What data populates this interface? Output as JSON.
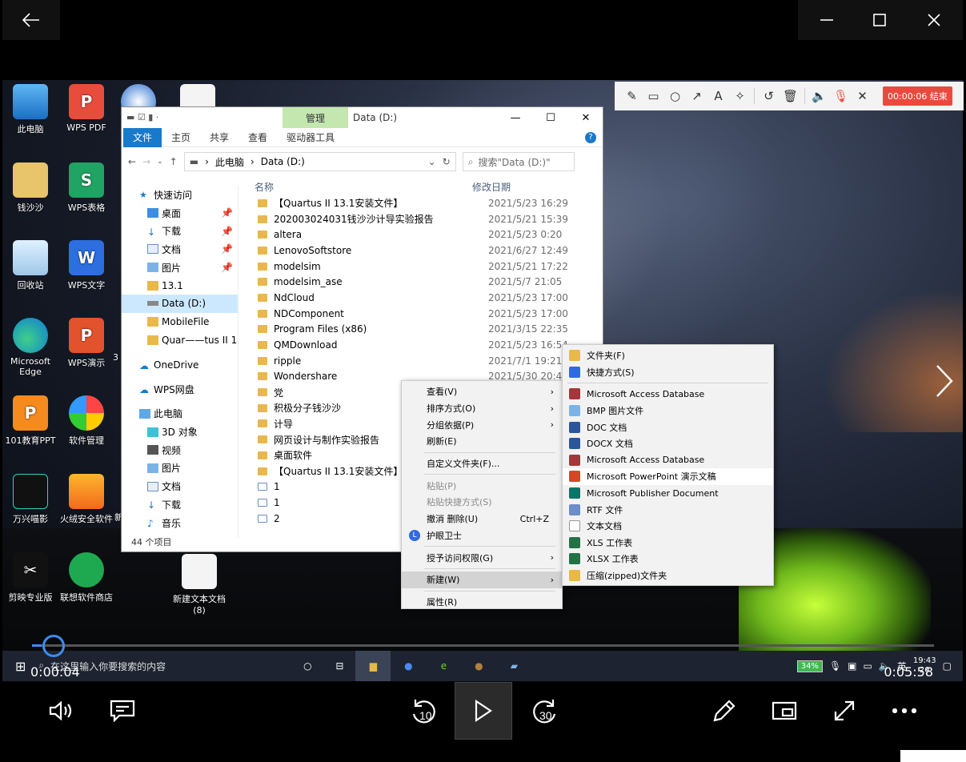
{
  "player": {
    "time_current": "0:00:04",
    "time_total": "0:05:58",
    "progress": 0.011,
    "skip_back": "10",
    "skip_forward": "30"
  },
  "recorder": {
    "end_label": "00:00:06 结束"
  },
  "desktop": {
    "icons": [
      {
        "label": "此电脑"
      },
      {
        "label": "WPS PDF"
      },
      {
        "label": "钱沙沙"
      },
      {
        "label": "WPS表格"
      },
      {
        "label": "回收站"
      },
      {
        "label": "WPS文字"
      },
      {
        "label": "Microsoft Edge"
      },
      {
        "label": "WPS演示"
      },
      {
        "label": "101教育PPT"
      },
      {
        "label": "软件管理"
      },
      {
        "label": "万兴喵影"
      },
      {
        "label": "火绒安全软件"
      },
      {
        "label": "剪映专业版"
      },
      {
        "label": "联想软件商店"
      },
      {
        "label": "新建文本文档 (8)"
      }
    ],
    "partial_labels": [
      "1",
      "3",
      "新"
    ]
  },
  "explorer": {
    "manage_tab": "管理",
    "title": "Data (D:)",
    "ribbon": [
      "文件",
      "主页",
      "共享",
      "查看",
      "驱动器工具"
    ],
    "breadcrumb": [
      "此电脑",
      "Data (D:)"
    ],
    "search_placeholder": "搜索\"Data (D:)\"",
    "col_name": "名称",
    "col_date": "修改日期",
    "nav": [
      {
        "label": "快速访问"
      },
      {
        "label": "桌面"
      },
      {
        "label": "下载"
      },
      {
        "label": "文档"
      },
      {
        "label": "图片"
      },
      {
        "label": "13.1"
      },
      {
        "label": "Data (D:)"
      },
      {
        "label": "MobileFile"
      },
      {
        "label": "Quar——tus II 1"
      },
      {
        "label": "OneDrive"
      },
      {
        "label": "WPS网盘"
      },
      {
        "label": "此电脑"
      },
      {
        "label": "3D 对象"
      },
      {
        "label": "视频"
      },
      {
        "label": "图片"
      },
      {
        "label": "文档"
      },
      {
        "label": "下载"
      },
      {
        "label": "音乐"
      }
    ],
    "files": [
      {
        "name": "【Quartus II 13.1安装文件】",
        "date": "2021/5/23 16:29"
      },
      {
        "name": "202003024031钱沙沙计导实验报告",
        "date": "2021/5/21 15:39"
      },
      {
        "name": "altera",
        "date": "2021/5/23 0:20"
      },
      {
        "name": "LenovoSoftstore",
        "date": "2021/6/27 12:49"
      },
      {
        "name": "modelsim",
        "date": "2021/5/21 17:22"
      },
      {
        "name": "modelsim_ase",
        "date": "2021/5/7 21:05"
      },
      {
        "name": "NdCloud",
        "date": "2021/5/23 17:00"
      },
      {
        "name": "NDComponent",
        "date": "2021/5/23 17:00"
      },
      {
        "name": "Program Files (x86)",
        "date": "2021/3/15 22:35"
      },
      {
        "name": "QMDownload",
        "date": "2021/5/23 16:54"
      },
      {
        "name": "ripple",
        "date": "2021/7/1 19:21"
      },
      {
        "name": "Wondershare",
        "date": "2021/5/30 20:47"
      },
      {
        "name": "党",
        "date": ""
      },
      {
        "name": "积极分子钱沙沙",
        "date": ""
      },
      {
        "name": "计导",
        "date": ""
      },
      {
        "name": "网页设计与制作实验报告",
        "date": ""
      },
      {
        "name": "桌面软件",
        "date": ""
      },
      {
        "name": "【Quartus II 13.1安装文件】★★",
        "date": ""
      },
      {
        "name": "1",
        "date": ""
      },
      {
        "name": "1",
        "date": ""
      },
      {
        "name": "2",
        "date": ""
      }
    ],
    "status": "44 个项目"
  },
  "context_menu": {
    "items": [
      {
        "label": "查看(V)",
        "arrow": "›"
      },
      {
        "label": "排序方式(O)",
        "arrow": "›"
      },
      {
        "label": "分组依据(P)",
        "arrow": "›"
      },
      {
        "label": "刷新(E)"
      },
      {
        "label": "自定义文件夹(F)..."
      },
      {
        "label": "粘贴(P)"
      },
      {
        "label": "粘贴快捷方式(S)"
      },
      {
        "label": "撤消 删除(U)",
        "shortcut": "Ctrl+Z"
      },
      {
        "label": "护眼卫士"
      },
      {
        "label": "授予访问权限(G)",
        "arrow": "›"
      },
      {
        "label": "新建(W)",
        "arrow": "›"
      },
      {
        "label": "属性(R)"
      }
    ]
  },
  "submenu": {
    "items": [
      {
        "label": "文件夹(F)"
      },
      {
        "label": "快捷方式(S)"
      },
      {
        "label": "Microsoft Access Database"
      },
      {
        "label": "BMP 图片文件"
      },
      {
        "label": "DOC 文档"
      },
      {
        "label": "DOCX 文档"
      },
      {
        "label": "Microsoft Access Database"
      },
      {
        "label": "Microsoft PowerPoint 演示文稿"
      },
      {
        "label": "Microsoft Publisher Document"
      },
      {
        "label": "RTF 文件"
      },
      {
        "label": "文本文档"
      },
      {
        "label": "XLS 工作表"
      },
      {
        "label": "XLSX 工作表"
      },
      {
        "label": "压缩(zipped)文件夹"
      }
    ]
  },
  "taskbar": {
    "search_placeholder": "在这里输入你要搜索的内容",
    "battery": "34%",
    "ime": "英",
    "clock": "19:43",
    "date_partial": "20"
  }
}
